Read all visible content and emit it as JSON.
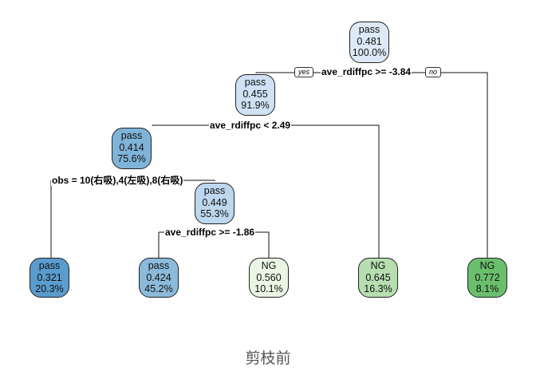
{
  "tree": {
    "root": {
      "class": "pass",
      "prob": "0.481",
      "pct": "100.0%",
      "color": "#dde9f6"
    },
    "n2": {
      "class": "pass",
      "prob": "0.455",
      "pct": "91.9%",
      "color": "#cfe1f3"
    },
    "n4": {
      "class": "pass",
      "prob": "0.414",
      "pct": "75.6%",
      "color": "#7fb3d8"
    },
    "n9": {
      "class": "pass",
      "prob": "0.449",
      "pct": "55.3%",
      "color": "#bcd7ee"
    },
    "leaves": [
      {
        "class": "pass",
        "prob": "0.321",
        "pct": "20.3%",
        "color": "#5a9ccd"
      },
      {
        "class": "pass",
        "prob": "0.424",
        "pct": "45.2%",
        "color": "#8cbada"
      },
      {
        "class": "NG",
        "prob": "0.560",
        "pct": "10.1%",
        "color": "#eaf5e4"
      },
      {
        "class": "NG",
        "prob": "0.645",
        "pct": "16.3%",
        "color": "#b6deaf"
      },
      {
        "class": "NG",
        "prob": "0.772",
        "pct": "8.1%",
        "color": "#6abf6c"
      }
    ],
    "splits": {
      "root": "ave_rdiffpc >= -3.84",
      "n2": "ave_rdiffpc < 2.49",
      "n4": "obs = 10(右吸),4(左吸),8(右吸)",
      "n9": "ave_rdiffpc >= -1.86"
    },
    "branch_tags": {
      "yes": "yes",
      "no": "no"
    }
  },
  "caption": "剪枝前"
}
